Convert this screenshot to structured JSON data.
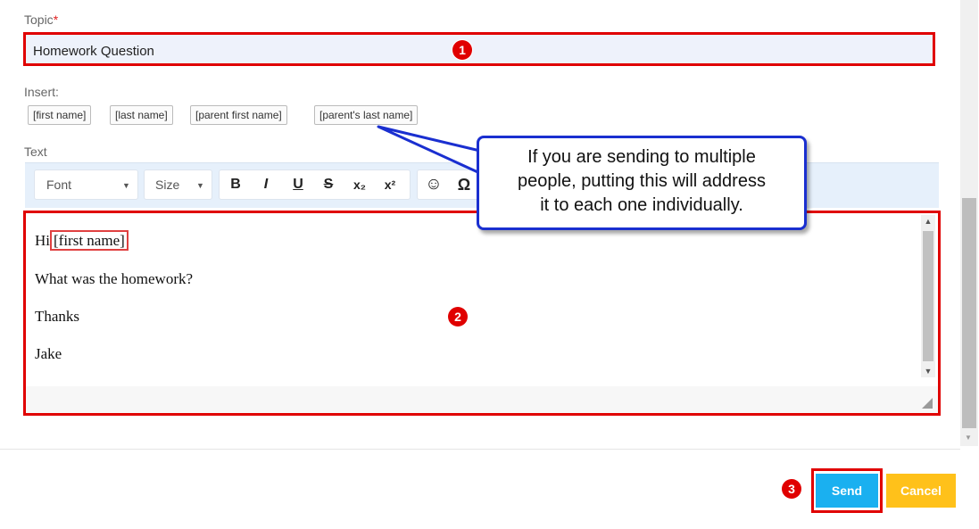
{
  "topic": {
    "label": "Topic",
    "required_mark": "*",
    "value": "Homework Question"
  },
  "insert": {
    "label": "Insert:",
    "buttons": [
      "[first name]",
      "[last name]",
      "[parent first name]",
      "[parent's last name]"
    ]
  },
  "text_section": {
    "label": "Text"
  },
  "toolbar": {
    "font_label": "Font",
    "size_label": "Size",
    "bold": "B",
    "italic": "I",
    "underline": "U",
    "strike": "S",
    "subscript": "x₂",
    "superscript": "x²",
    "emoji": "☺",
    "special_char": "Ω"
  },
  "editor": {
    "greeting": "Hi",
    "placeholder_token": "[first name]",
    "line2": "What was the homework?",
    "line3": "Thanks",
    "line4": "Jake"
  },
  "callout": {
    "line1": "If you are sending to multiple",
    "line2": "people, putting this will address",
    "line3": "it to each one individually."
  },
  "badges": [
    "1",
    "2",
    "3"
  ],
  "actions": {
    "send_label": "Send",
    "cancel_label": "Cancel"
  },
  "colors": {
    "highlight_red": "#e00000",
    "send_blue": "#1ab0f0",
    "cancel_yellow": "#ffc11a",
    "callout_border": "#1a2fd0"
  }
}
